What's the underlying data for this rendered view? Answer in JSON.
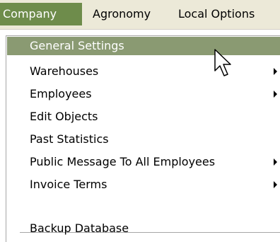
{
  "menubar": {
    "items": [
      {
        "label": "Company",
        "active": true
      },
      {
        "label": "Agronomy",
        "active": false
      },
      {
        "label": "Local Options",
        "active": false
      }
    ]
  },
  "menu": {
    "items": [
      {
        "label": "General Settings",
        "submenu": false,
        "highlighted": true
      },
      {
        "label": "Warehouses",
        "submenu": true,
        "highlighted": false
      },
      {
        "label": "Employees",
        "submenu": true,
        "highlighted": false
      },
      {
        "label": "Edit Objects",
        "submenu": false,
        "highlighted": false
      },
      {
        "label": "Past Statistics",
        "submenu": false,
        "highlighted": false
      },
      {
        "label": "Public Message To All Employees",
        "submenu": true,
        "highlighted": false
      },
      {
        "label": "Invoice Terms",
        "submenu": true,
        "highlighted": false
      },
      {
        "label": "Backup Database",
        "submenu": false,
        "highlighted": false
      }
    ]
  },
  "cursor": {
    "icon": "arrow-cursor-icon"
  },
  "colors": {
    "active_menu_bg": "#6e8c4b",
    "highlight_bg": "#8a9a72",
    "menubar_bg": "#ece9d8"
  }
}
